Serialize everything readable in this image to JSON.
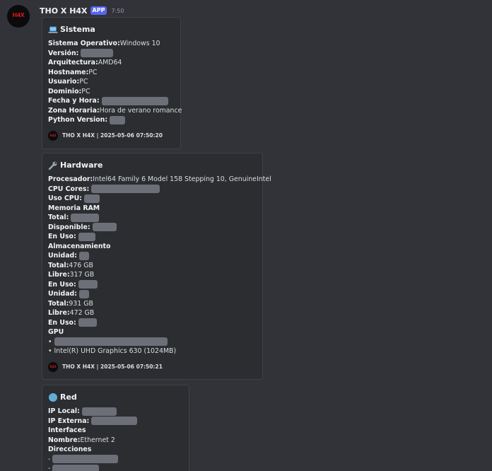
{
  "message": {
    "username": "THO X H4X",
    "badge": "APP",
    "time": "7:50",
    "avatar_text": "H4X"
  },
  "colors": {
    "background": "#313338",
    "embed_background": "#2b2d31",
    "badge": "#5865f2",
    "redaction": "#6d6f78",
    "avatar_accent": "#d01616"
  },
  "embeds": [
    {
      "icon": "laptop-icon",
      "title": "Sistema",
      "fields": [
        {
          "key": "Sistema Operativo",
          "value": " Windows 10"
        },
        {
          "key": "Versión",
          "value": ""
        },
        {
          "key": "Arquitectura",
          "value": " AMD64"
        },
        {
          "key": "Hostname",
          "value": " PC"
        },
        {
          "key": "Usuario",
          "value": " PC"
        },
        {
          "key": "Dominio",
          "value": " PC"
        },
        {
          "key": "Fecha y Hora",
          "value": ""
        },
        {
          "key": "Zona Horaria",
          "value": " Hora de verano romance"
        },
        {
          "key": "Python Version",
          "value": ""
        }
      ],
      "footer": "THO X H4X | 2025-05-06 07:50:20"
    },
    {
      "icon": "wrench-icon",
      "title": "Hardware",
      "fields": [
        {
          "key": "Procesador",
          "value": " Intel64 Family 6 Model 158 Stepping 10, GenuineIntel"
        },
        {
          "key": "CPU Cores",
          "value": ""
        },
        {
          "key": "Uso CPU",
          "value": ""
        },
        {
          "key": "Memoria RAM",
          "value": ""
        },
        {
          "key": "Total",
          "value": ""
        },
        {
          "key": "Disponible",
          "value": ""
        },
        {
          "key": "En Uso",
          "value": ""
        },
        {
          "key": "Almacenamiento",
          "value": ""
        },
        {
          "key": "Unidad",
          "value": ""
        },
        {
          "key": "Total",
          "value": " 476 GB"
        },
        {
          "key": "Libre",
          "value": " 317 GB"
        },
        {
          "key": "En Uso",
          "value": ""
        },
        {
          "key": "Unidad",
          "value": ""
        },
        {
          "key": "Total",
          "value": " 931 GB"
        },
        {
          "key": "Libre",
          "value": " 472 GB"
        },
        {
          "key": "En Uso",
          "value": ""
        },
        {
          "key": "GPU",
          "value": ""
        },
        {
          "key": "",
          "value": "•"
        },
        {
          "key": "",
          "value": "• Intel(R) UHD Graphics 630 (1024MB)"
        }
      ],
      "footer": "THO X H4X | 2025-05-06 07:50:21"
    },
    {
      "icon": "globe-icon",
      "title": "Red",
      "fields": [
        {
          "key": "IP Local",
          "value": ""
        },
        {
          "key": "IP Externa",
          "value": ""
        },
        {
          "key": "Interfaces",
          "value": ""
        },
        {
          "key": "Nombre",
          "value": " Ethernet 2"
        },
        {
          "key": "Direcciones",
          "value": ""
        },
        {
          "key": "",
          "value": "-"
        },
        {
          "key": "",
          "value": "-"
        }
      ]
    }
  ]
}
